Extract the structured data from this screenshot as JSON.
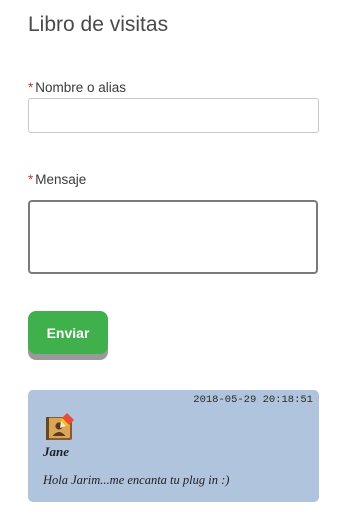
{
  "form": {
    "title": "Libro de visitas",
    "required_marker": "*",
    "name_label": "Nombre o alias",
    "name_value": "",
    "message_label": "Mensaje",
    "message_value": "",
    "submit_label": "Enviar"
  },
  "entries": [
    {
      "date": "2018-05-29 20:18:51",
      "author": "Jane",
      "message": "Hola Jarim...me encanta tu plug in :)",
      "icon": "address-book-icon"
    }
  ],
  "colors": {
    "submit_bg": "#3fb04c",
    "entry_bg": "#b0c4de",
    "required_marker": "#c0392b"
  }
}
